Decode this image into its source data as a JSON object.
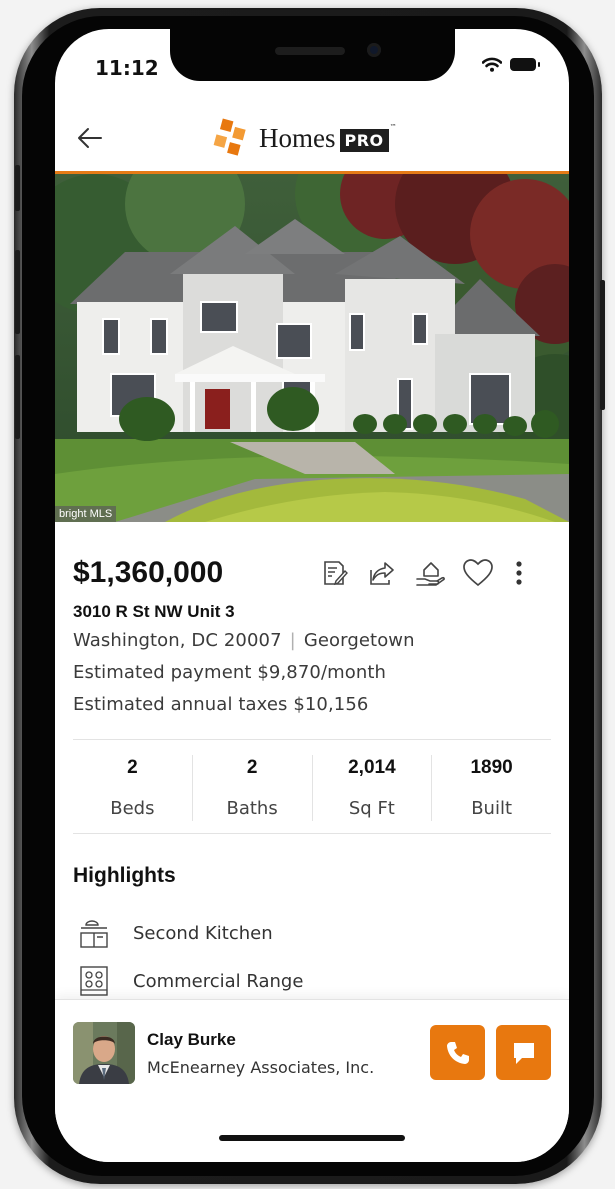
{
  "status_bar": {
    "time": "11:12"
  },
  "brand": {
    "name": "Homes",
    "tier": "PRO",
    "trademark": "™",
    "accent_color": "#e8780f"
  },
  "listing": {
    "photo_credit": "bright MLS",
    "price": "$1,360,000",
    "address_line": "3010 R St NW Unit 3",
    "city_state_zip": "Washington, DC 20007",
    "separator": "|",
    "neighborhood": "Georgetown",
    "estimated_payment": "Estimated payment $9,870/month",
    "estimated_taxes": "Estimated annual taxes $10,156",
    "actions": [
      "notes-icon",
      "share-icon",
      "home-value-icon",
      "heart-icon",
      "more-vertical-icon"
    ],
    "stats": [
      {
        "value": "2",
        "label": "Beds"
      },
      {
        "value": "2",
        "label": "Baths"
      },
      {
        "value": "2,014",
        "label": "Sq Ft"
      },
      {
        "value": "1890",
        "label": "Built"
      }
    ],
    "highlights_title": "Highlights",
    "highlights": [
      {
        "icon": "kitchen-icon",
        "label": "Second Kitchen"
      },
      {
        "icon": "range-icon",
        "label": "Commercial Range"
      }
    ]
  },
  "agent": {
    "name": "Clay Burke",
    "company": "McEnearney Associates, Inc.",
    "call_icon": "phone-icon",
    "message_icon": "chat-icon"
  }
}
